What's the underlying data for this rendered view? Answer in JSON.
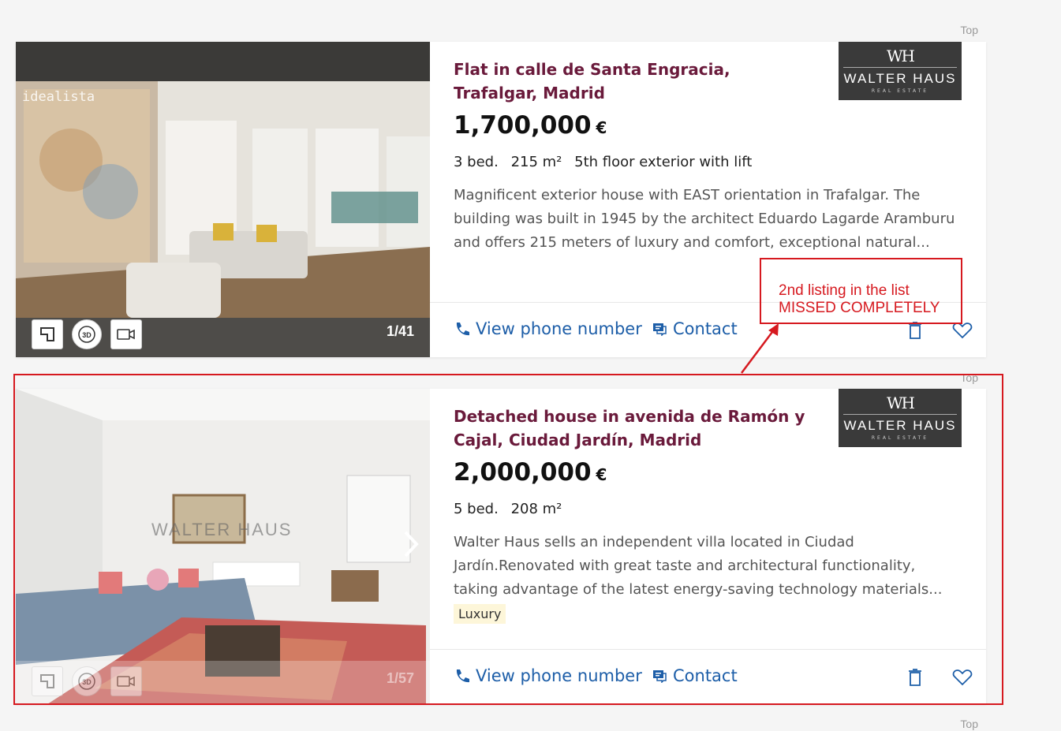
{
  "top_label": "Top",
  "listings": [
    {
      "title": "Flat in calle de Santa Engracia, Trafalgar, Madrid",
      "price": "1,700,000",
      "currency": "€",
      "details": [
        "3 bed.",
        "215 m²",
        "5th floor exterior with lift"
      ],
      "description": "Magnificent exterior house with EAST orientation in Trafalgar. The building was built in 1945 by the architect Eduardo Lagarde Aramburu and offers 215 meters of luxury and comfort, exceptional natural...",
      "photo_counter": "1/41",
      "watermark": "idealista",
      "agency_logo": {
        "name": "WALTER HAUS",
        "monogram": "WH",
        "subtitle": "REAL ESTATE"
      },
      "phone_label": "View phone number",
      "contact_label": "Contact"
    },
    {
      "title": "Detached house in avenida de Ramón y Cajal, Ciudad Jardín, Madrid",
      "price": "2,000,000",
      "currency": "€",
      "details": [
        "5 bed.",
        "208 m²"
      ],
      "description": "Walter Haus sells an independent villa located in Ciudad Jardín.Renovated with great taste and architectural functionality, taking advantage of the latest energy-saving technology materials...",
      "tag": "Luxury",
      "photo_counter": "1/57",
      "watermark": "WALTER HAUS",
      "agency_logo": {
        "name": "WALTER HAUS",
        "monogram": "WH",
        "subtitle": "REAL ESTATE"
      },
      "phone_label": "View phone number",
      "contact_label": "Contact"
    }
  ],
  "annotation": {
    "line1": "2nd listing in the list",
    "line2": "MISSED COMPLETELY",
    "color": "#d6191f"
  },
  "colors": {
    "title": "#6a1a3b",
    "link": "#1d5ea8"
  }
}
